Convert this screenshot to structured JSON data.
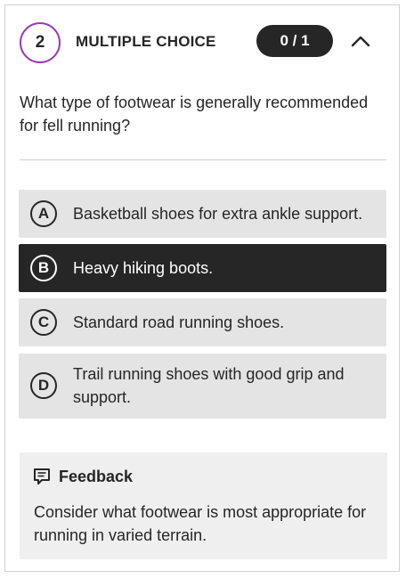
{
  "question": {
    "number": "2",
    "type_label": "MULTIPLE CHOICE",
    "score": "0 / 1",
    "text": "What type of footwear is generally recommended for fell running?"
  },
  "options": [
    {
      "letter": "A",
      "text": "Basketball shoes for extra ankle support.",
      "selected": false
    },
    {
      "letter": "B",
      "text": "Heavy hiking boots.",
      "selected": true
    },
    {
      "letter": "C",
      "text": "Standard road running shoes.",
      "selected": false
    },
    {
      "letter": "D",
      "text": "Trail running shoes with good grip and support.",
      "selected": false
    }
  ],
  "feedback": {
    "title": "Feedback",
    "text": "Consider what footwear is most appropriate for running in varied terrain."
  },
  "icons": {
    "collapse": "chevron-up-icon",
    "feedback": "comment-icon"
  },
  "colors": {
    "accent": "#9b3ab3",
    "dark": "#262626",
    "option_bg": "#e4e4e4",
    "feedback_bg": "#efefef"
  }
}
